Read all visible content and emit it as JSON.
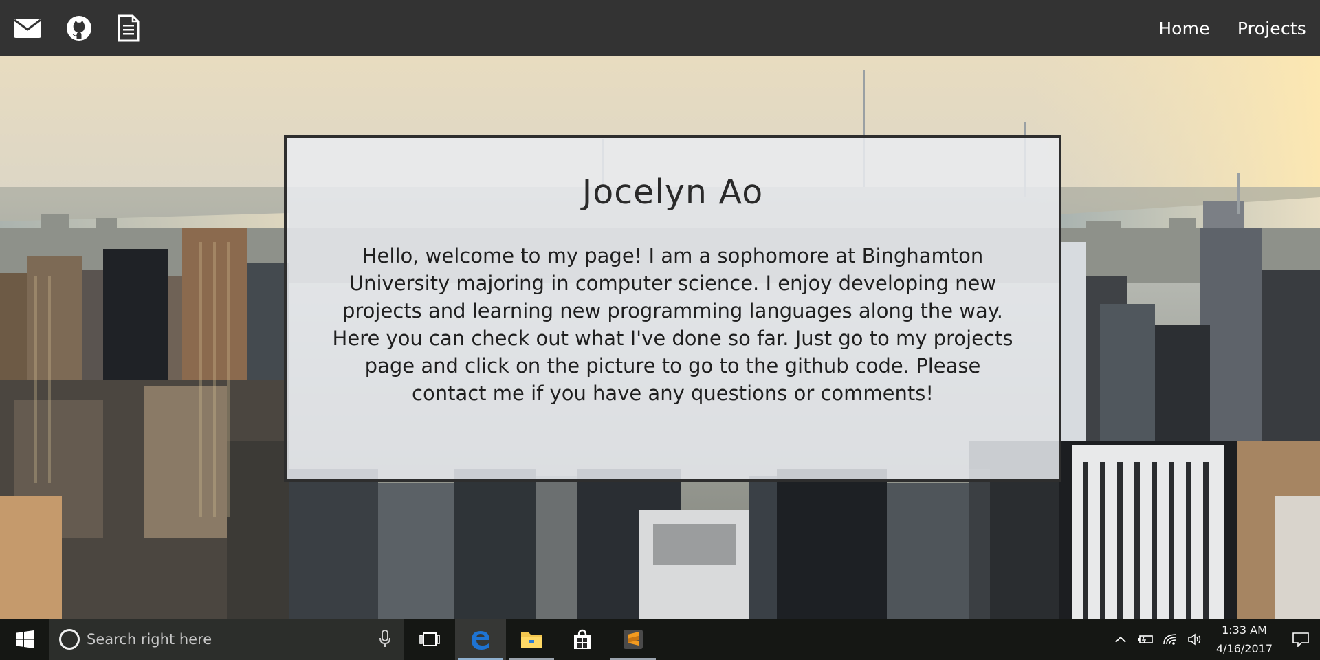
{
  "navbar": {
    "icons": [
      "mail-icon",
      "github-icon",
      "document-icon"
    ],
    "links": [
      {
        "label": "Home"
      },
      {
        "label": "Projects"
      }
    ]
  },
  "card": {
    "title": "Jocelyn Ao",
    "text": "Hello, welcome to my page! I am a sophomore at Binghamton University majoring in computer science. I enjoy developing new projects and learning new programming languages along the way. Here you can check out what I've done so far. Just go to my projects page and click on the picture to go to the github code. Please contact me if you have any questions or comments!"
  },
  "taskbar": {
    "search_placeholder": "Search right here",
    "pinned": [
      "task-view-icon",
      "edge-icon",
      "file-explorer-icon",
      "store-icon",
      "sublime-text-icon"
    ],
    "tray": [
      "chevron-up-icon",
      "battery-icon",
      "wifi-icon",
      "volume-icon"
    ],
    "time": "1:33 AM",
    "date": "4/16/2017"
  },
  "colors": {
    "navbar_bg": "#333333",
    "card_border": "#2e2e2e",
    "card_bg": "rgba(233,236,241,0.84)",
    "edge_blue": "#1e73d2",
    "sublime_orange": "#f29a1f"
  }
}
